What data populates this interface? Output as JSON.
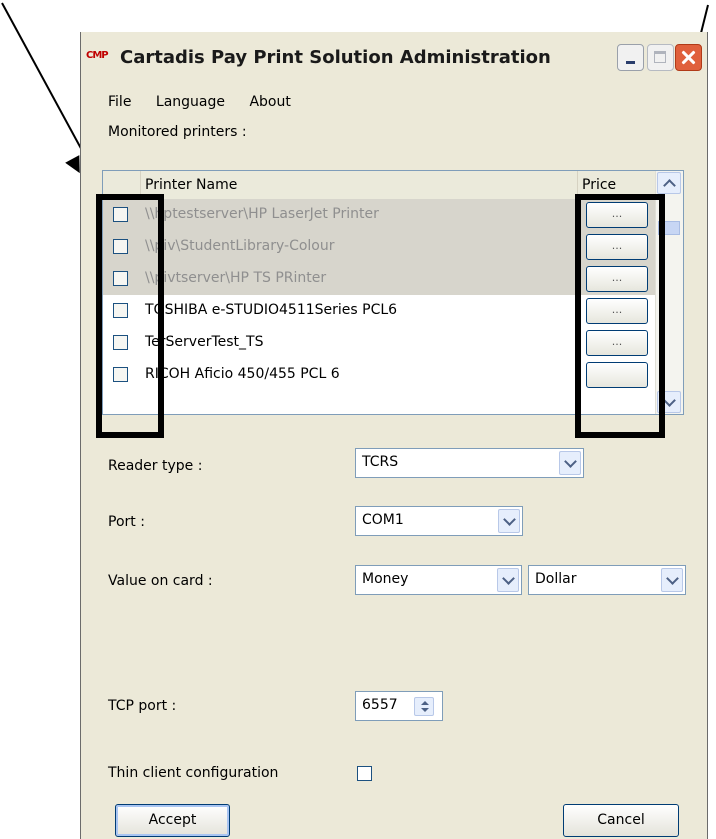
{
  "window": {
    "title": "Cartadis Pay Print Solution Administration",
    "app_icon_text": "CMP"
  },
  "menu": [
    "File",
    "Language",
    "About"
  ],
  "monitored_label": "Monitored printers :",
  "table": {
    "headers": {
      "name": "Printer Name",
      "price": "Price"
    },
    "rows": [
      {
        "name": "\\\\hptestserver\\HP LaserJet Printer",
        "disabled": true,
        "price_button": "..."
      },
      {
        "name": "\\\\piv\\StudentLibrary-Colour",
        "disabled": true,
        "price_button": "..."
      },
      {
        "name": "\\\\pivtserver\\HP TS PRinter",
        "disabled": true,
        "price_button": "..."
      },
      {
        "name": "TOSHIBA e-STUDIO4511Series PCL6",
        "disabled": false,
        "price_button": "..."
      },
      {
        "name": "TerServerTest_TS",
        "disabled": false,
        "price_button": "..."
      },
      {
        "name": "RICOH Aficio 450/455 PCL 6",
        "disabled": false,
        "price_button": ""
      }
    ]
  },
  "form": {
    "reader_type": {
      "label": "Reader type :",
      "value": "TCRS"
    },
    "port": {
      "label": "Port :",
      "value": "COM1"
    },
    "value_on_card": {
      "label": "Value on card :",
      "value": "Money",
      "currency": "Dollar"
    },
    "tcp_port": {
      "label": "TCP port :",
      "value": "6557"
    },
    "thin_client": {
      "label": "Thin client configuration",
      "checked": false
    }
  },
  "buttons": {
    "accept": "Accept",
    "cancel": "Cancel"
  }
}
